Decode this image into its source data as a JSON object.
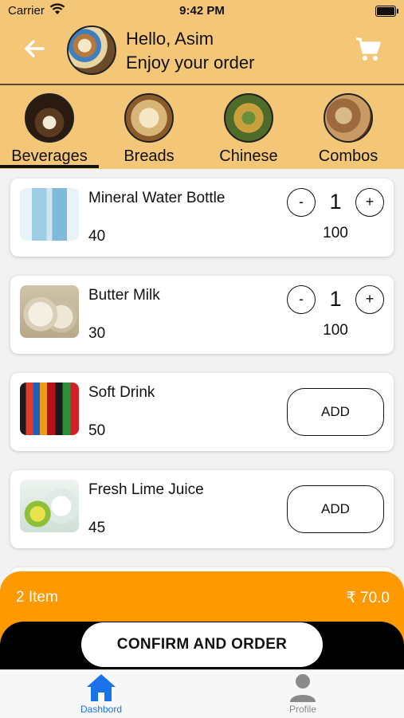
{
  "status_bar": {
    "carrier": "Carrier",
    "time": "9:42 PM"
  },
  "header": {
    "greeting": "Hello, Asim",
    "subtitle": "Enjoy your order",
    "icons": {
      "back": "back-arrow-icon",
      "cart": "cart-icon"
    }
  },
  "categories": [
    {
      "label": "Beverages",
      "selected": true
    },
    {
      "label": "Breads",
      "selected": false
    },
    {
      "label": "Chinese",
      "selected": false
    },
    {
      "label": "Combos",
      "selected": false
    }
  ],
  "items": [
    {
      "name": "Mineral Water Bottle",
      "price": "40",
      "in_cart": true,
      "qty": "1",
      "subtotal": "100"
    },
    {
      "name": "Butter Milk",
      "price": "30",
      "in_cart": true,
      "qty": "1",
      "subtotal": "100"
    },
    {
      "name": "Soft Drink",
      "price": "50",
      "in_cart": false,
      "add_label": "ADD"
    },
    {
      "name": "Fresh Lime Juice",
      "price": "45",
      "in_cart": false,
      "add_label": "ADD"
    }
  ],
  "stepper": {
    "minus": "-",
    "plus": "+"
  },
  "order_bar": {
    "items_text": "2 Item",
    "total_text": "₹ 70.0",
    "confirm_label": "CONFIRM AND ORDER"
  },
  "tab_bar": [
    {
      "label": "Dashbord",
      "icon": "home-icon",
      "active": true
    },
    {
      "label": "Profile",
      "icon": "person-icon",
      "active": false
    }
  ],
  "colors": {
    "header": "#f3c678",
    "accent": "#ff9900",
    "active_tab": "#1a73e8"
  }
}
